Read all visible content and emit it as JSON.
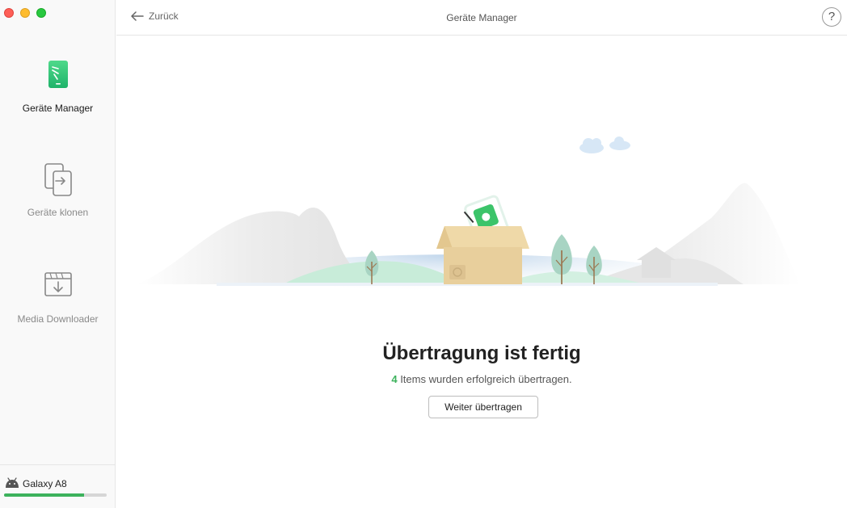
{
  "window": {
    "controls": [
      "close",
      "minimize",
      "zoom"
    ]
  },
  "sidebar": {
    "items": [
      {
        "label": "Geräte Manager",
        "icon": "phone-manager-icon",
        "active": true
      },
      {
        "label": "Geräte klonen",
        "icon": "clone-device-icon",
        "active": false
      },
      {
        "label": "Media Downloader",
        "icon": "media-downloader-icon",
        "active": false
      }
    ],
    "device": {
      "name": "Galaxy A8",
      "icon": "android-icon",
      "storage_fraction": 0.78
    }
  },
  "header": {
    "back_label": "Zurück",
    "title": "Geräte Manager",
    "help_label": "?"
  },
  "result": {
    "title": "Übertragung ist fertig",
    "count": "4",
    "message": " Items wurden erfolgreich übertragen.",
    "button_label": "Weiter übertragen"
  },
  "colors": {
    "accent": "#3cb25c",
    "close": "#fe5f57",
    "minimize": "#febc2e",
    "zoom": "#28c840"
  }
}
